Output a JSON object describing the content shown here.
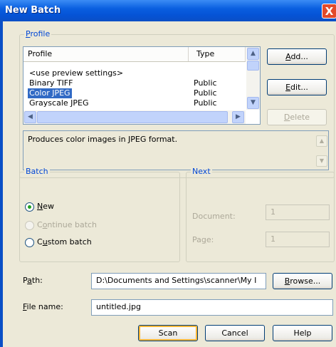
{
  "window": {
    "title": "New Batch",
    "close_label": "X"
  },
  "profile": {
    "legend": "Profile",
    "columns": [
      "Profile",
      "Type"
    ],
    "rows": [
      {
        "name": "<use preview settings>",
        "type": ""
      },
      {
        "name": "Binary TIFF",
        "type": "Public"
      },
      {
        "name": "Color JPEG",
        "type": "Public"
      },
      {
        "name": "Grayscale JPEG",
        "type": "Public"
      }
    ],
    "selected_index": 2,
    "buttons": {
      "add": "Add...",
      "edit": "Edit...",
      "delete": "Delete"
    },
    "description": "Produces color images in JPEG format."
  },
  "batch": {
    "legend": "Batch",
    "options": {
      "new": "New",
      "continue": "Continue batch",
      "custom": "Custom batch"
    },
    "selected": "new"
  },
  "next": {
    "legend": "Next",
    "document_label": "Document:",
    "document_value": "1",
    "page_label": "Page:",
    "page_value": "1"
  },
  "path": {
    "label": "Path:",
    "value": "D:\\Documents and Settings\\scanner\\My I",
    "browse": "Browse..."
  },
  "file_name": {
    "label": "File name:",
    "value": "untitled.jpg"
  },
  "footer": {
    "scan": "Scan",
    "cancel": "Cancel",
    "help": "Help"
  },
  "colors": {
    "title_bar": "#0a5fe0",
    "selection": "#316ac5",
    "group_legend": "#0046d5",
    "face": "#ece9d8"
  }
}
